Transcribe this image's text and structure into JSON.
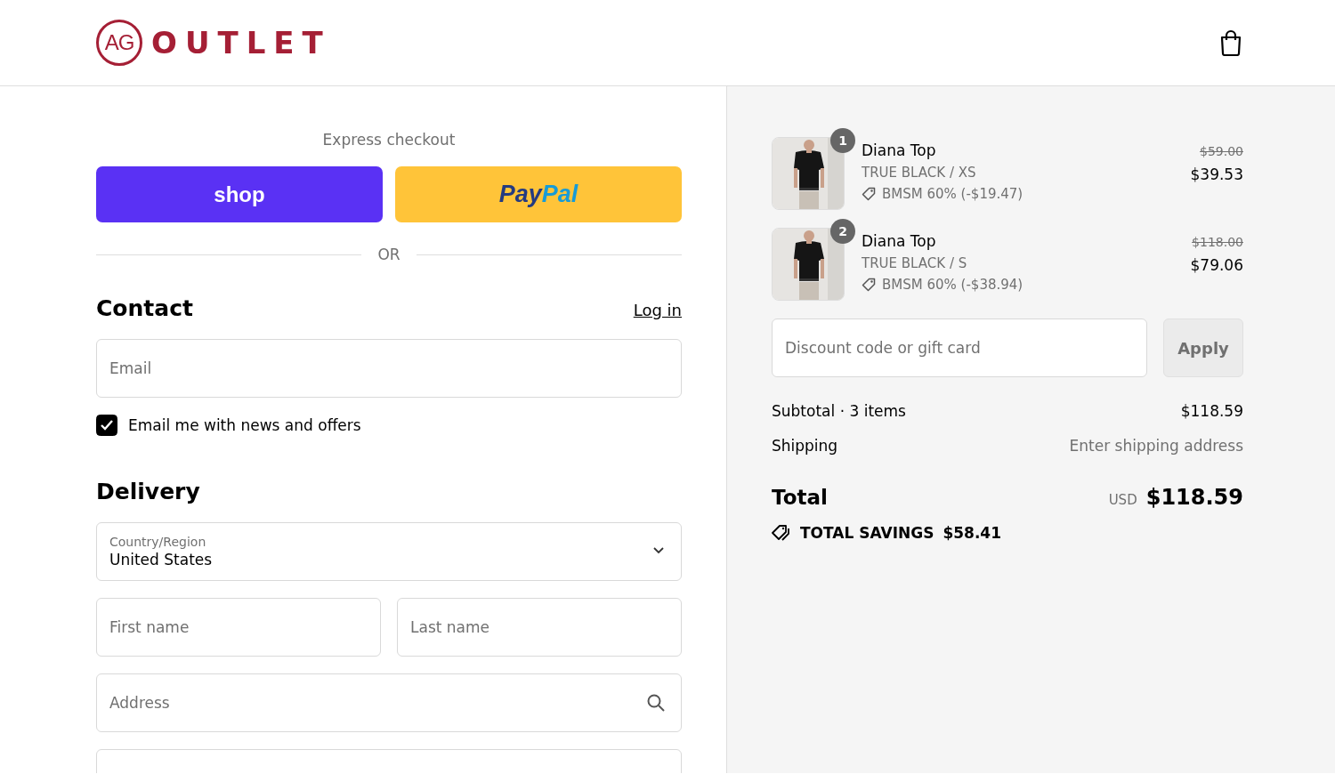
{
  "header": {
    "logo_mark": "AG",
    "logo_text": "OUTLET"
  },
  "express": {
    "title": "Express checkout",
    "shop_label": "shop",
    "paypal": [
      "Pay",
      "Pal"
    ],
    "divider": "OR"
  },
  "contact": {
    "heading": "Contact",
    "login": "Log in",
    "email": {
      "placeholder": "Email"
    },
    "newsletter": {
      "label": "Email me with news and offers",
      "checked": true
    }
  },
  "delivery": {
    "heading": "Delivery",
    "country": {
      "label": "Country/Region",
      "value": "United States"
    },
    "first_name": {
      "placeholder": "First name"
    },
    "last_name": {
      "placeholder": "Last name"
    },
    "address": {
      "placeholder": "Address"
    }
  },
  "cart": {
    "items": [
      {
        "quantity": "1",
        "name": "Diana Top",
        "variant": "TRUE BLACK / XS",
        "discount": "BMSM 60% (-$19.47)",
        "original_price": "$59.00",
        "price": "$39.53"
      },
      {
        "quantity": "2",
        "name": "Diana Top",
        "variant": "TRUE BLACK / S",
        "discount": "BMSM 60% (-$38.94)",
        "original_price": "$118.00",
        "price": "$79.06"
      }
    ],
    "discount_field": {
      "placeholder": "Discount code or gift card"
    },
    "apply": "Apply",
    "subtotal": {
      "label": "Subtotal · 3 items",
      "value": "$118.59"
    },
    "shipping": {
      "label": "Shipping",
      "value": "Enter shipping address"
    },
    "total": {
      "label": "Total",
      "currency": "USD",
      "value": "$118.59"
    },
    "savings": {
      "label": "TOTAL SAVINGS",
      "value": "$58.41"
    }
  }
}
